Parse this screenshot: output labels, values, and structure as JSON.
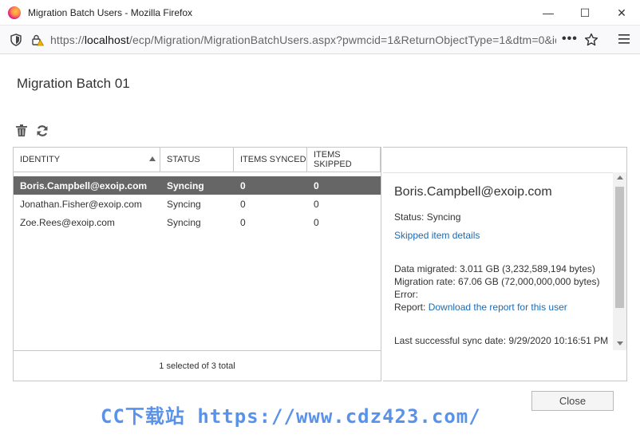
{
  "window": {
    "title": "Migration Batch Users - Mozilla Firefox",
    "minimize": "—",
    "maximize": "☐",
    "close": "✕"
  },
  "address_bar": {
    "url_prefix": "https://",
    "url_host": "localhost",
    "url_rest": "/ecp/Migration/MigrationBatchUsers.aspx?pwmcid=1&ReturnObjectType=1&dtm=0&id",
    "more": "•••"
  },
  "page": {
    "title": "Migration Batch 01"
  },
  "table": {
    "columns": [
      "IDENTITY",
      "STATUS",
      "ITEMS SYNCED",
      "ITEMS SKIPPED"
    ],
    "rows": [
      {
        "identity": "Boris.Campbell@exoip.com",
        "status": "Syncing",
        "synced": "0",
        "skipped": "0",
        "selected": true
      },
      {
        "identity": "Jonathan.Fisher@exoip.com",
        "status": "Syncing",
        "synced": "0",
        "skipped": "0",
        "selected": false
      },
      {
        "identity": "Zoe.Rees@exoip.com",
        "status": "Syncing",
        "synced": "0",
        "skipped": "0",
        "selected": false
      }
    ],
    "footer": "1 selected of 3 total"
  },
  "details": {
    "name": "Boris.Campbell@exoip.com",
    "status": "Status: Syncing",
    "skipped_link": "Skipped item details",
    "data_migrated": "Data migrated: 3.011 GB (3,232,589,194 bytes)",
    "migration_rate": "Migration rate: 67.06 GB (72,000,000,000 bytes)",
    "error": "Error:",
    "report_label": "Report: ",
    "report_link": "Download the report for this user",
    "last_sync": "Last successful sync date: 9/29/2020 10:16:51 PM"
  },
  "buttons": {
    "close": "Close"
  },
  "watermark": "CC下载站 https://www.cdz423.com/"
}
